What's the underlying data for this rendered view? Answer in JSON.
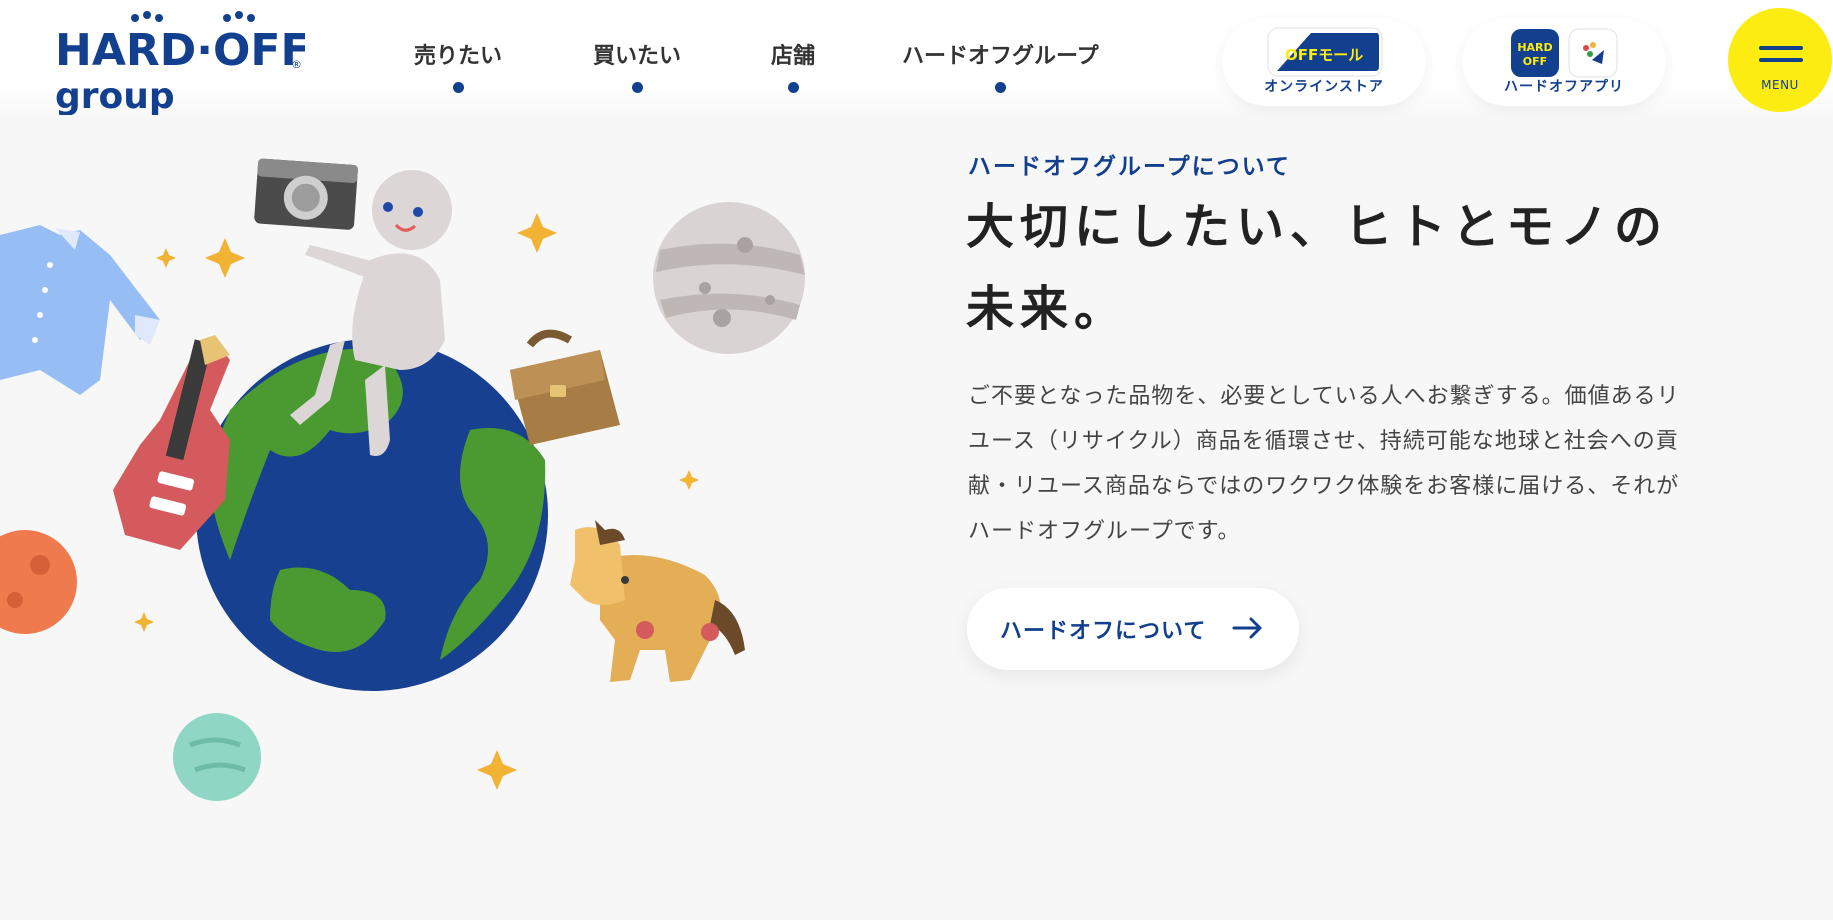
{
  "brand": {
    "logo_top": "HARD·OFF",
    "logo_bottom": "group",
    "logo_mark": "®",
    "primary_color": "#12408f",
    "accent_color": "#fcec12"
  },
  "nav": {
    "items": [
      {
        "label": "売りたい"
      },
      {
        "label": "買いたい"
      },
      {
        "label": "店舗"
      },
      {
        "label": "ハードオフグループ"
      }
    ]
  },
  "header_links": {
    "online_store": {
      "label": "オンラインストア",
      "badge_text": "OFFモール"
    },
    "app": {
      "label": "ハードオフアプリ",
      "badge_text": "HARD OFF"
    }
  },
  "menu": {
    "label": "MENU"
  },
  "content": {
    "kicker": "ハードオフグループについて",
    "headline": "大切にしたい、ヒトとモノの未来。",
    "body": "ご不要となった品物を、必要としている人へお繋ぎする。価値あるリユース（リサイクル）商品を循環させ、持続可能な地球と社会への貢献・リユース商品ならではのワクワク体験をお客様に届ける、それがハードオフグループです。",
    "cta_label": "ハードオフについて"
  },
  "illustration": {
    "icons": [
      "earth-icon",
      "robot-figure-icon",
      "camera-icon",
      "shirt-icon",
      "guitar-icon",
      "bag-icon",
      "horse-toy-icon",
      "planet-icon",
      "sparkle-icon"
    ]
  }
}
